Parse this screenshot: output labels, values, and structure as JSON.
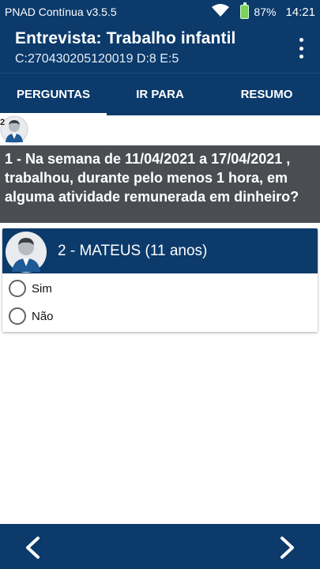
{
  "status_bar": {
    "app_name": "PNAD Contínua v3.5.5",
    "battery": "87%",
    "time": "14:21"
  },
  "header": {
    "title": "Entrevista: Trabalho infantil",
    "subtitle": "C:270430205120019 D:8 E:5"
  },
  "tabs": [
    {
      "label": "PERGUNTAS",
      "active": true
    },
    {
      "label": "IR PARA",
      "active": false
    },
    {
      "label": "RESUMO",
      "active": false
    }
  ],
  "person_number": "2",
  "question": {
    "text": "1 - Na semana de 11/04/2021 a 17/04/2021 , trabalhou, durante pelo menos 1 hora, em alguma atividade remunerada em dinheiro?"
  },
  "member": {
    "name": "2 - MATEUS (11 anos)"
  },
  "options": [
    {
      "label": "Sim",
      "selected": false
    },
    {
      "label": "Não",
      "selected": false
    }
  ],
  "colors": {
    "primary": "#0b3a6b",
    "question_bg": "#4a4e53"
  }
}
